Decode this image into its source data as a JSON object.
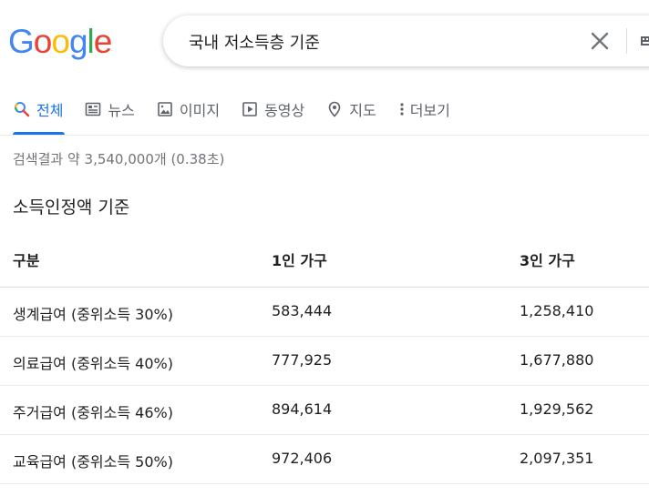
{
  "logo": {
    "letters": [
      {
        "ch": "G",
        "color": "#4285F4"
      },
      {
        "ch": "o",
        "color": "#EA4335"
      },
      {
        "ch": "o",
        "color": "#FBBC05"
      },
      {
        "ch": "g",
        "color": "#4285F4"
      },
      {
        "ch": "l",
        "color": "#34A853"
      },
      {
        "ch": "e",
        "color": "#EA4335"
      }
    ]
  },
  "search": {
    "query": "국내 저소득층 기준"
  },
  "tabs": [
    {
      "label": "전체",
      "icon": "search-icon",
      "active": true
    },
    {
      "label": "뉴스",
      "icon": "news-icon",
      "active": false
    },
    {
      "label": "이미지",
      "icon": "image-icon",
      "active": false
    },
    {
      "label": "동영상",
      "icon": "video-icon",
      "active": false
    },
    {
      "label": "지도",
      "icon": "map-pin-icon",
      "active": false
    },
    {
      "label": "더보기",
      "icon": "more-vert-icon",
      "active": false
    }
  ],
  "results": {
    "stats": "검색결과 약 3,540,000개 (0.38초)"
  },
  "snippet": {
    "title": "소득인정액 기준",
    "table": {
      "headers": [
        "구분",
        "1인 가구",
        "3인 가구"
      ],
      "rows": [
        [
          "생계급여 (중위소득 30%)",
          "583,444",
          "1,258,410"
        ],
        [
          "의료급여 (중위소득 40%)",
          "777,925",
          "1,677,880"
        ],
        [
          "주거급여 (중위소득 46%)",
          "894,614",
          "1,929,562"
        ],
        [
          "교육급여 (중위소득 50%)",
          "972,406",
          "2,097,351"
        ]
      ]
    }
  },
  "colors": {
    "accent": "#1a73e8",
    "text": "#202124",
    "muted": "#5f6368",
    "stats": "#70757a"
  }
}
